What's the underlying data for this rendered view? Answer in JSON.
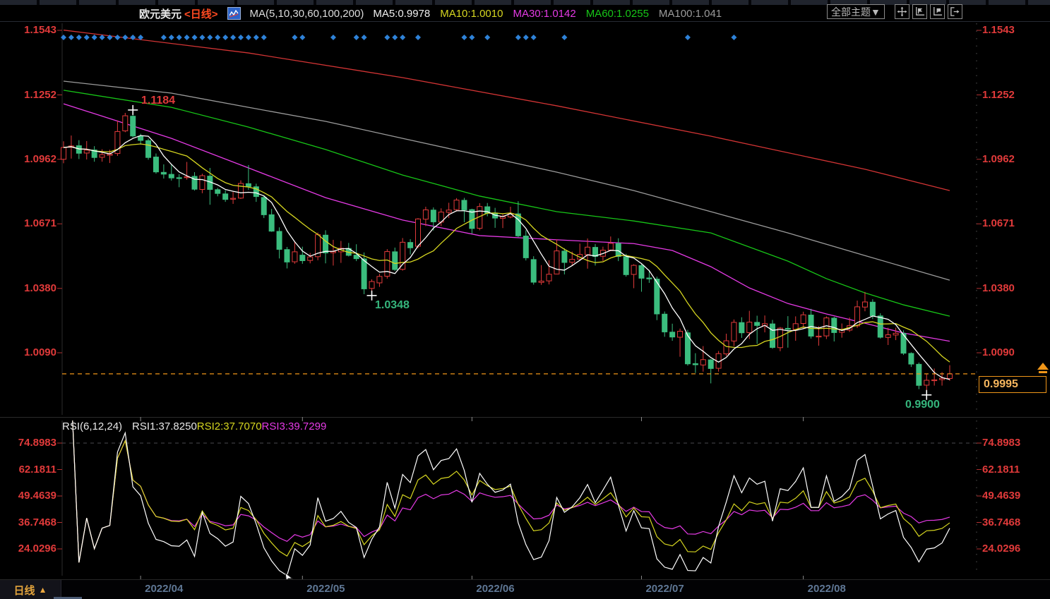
{
  "header": {
    "title": "欧元美元",
    "period_tag": "<日线>",
    "ma_param_label": "MA(5,10,30,60,100,200)",
    "ma_values": [
      {
        "label": "MA5:0.9978",
        "color": "#f0f0f0"
      },
      {
        "label": "MA10:1.0010",
        "color": "#d6d620"
      },
      {
        "label": "MA30:1.0142",
        "color": "#e53ae5"
      },
      {
        "label": "MA60:1.0255",
        "color": "#17c517"
      },
      {
        "label": "MA100:1.041",
        "color": "#9b9b9b"
      }
    ],
    "theme_button": "全部主题▼"
  },
  "main_chart": {
    "left_axis": [
      "1.1543",
      "1.1252",
      "1.0962",
      "1.0671",
      "1.0380",
      "1.0090"
    ],
    "right_axis": [
      "1.1543",
      "1.1252",
      "1.0962",
      "1.0671",
      "1.0380",
      "1.0090"
    ],
    "annotations": {
      "high": "1.1184",
      "low_may": "1.0348",
      "low_aug": "0.9900"
    },
    "current_price": "0.9995"
  },
  "rsi_panel": {
    "param_label": "RSI(6,12,24)",
    "values": [
      {
        "label": "RSI1:37.8250",
        "color": "#e8e8e8"
      },
      {
        "label": "RSI2:37.7070",
        "color": "#d6d620"
      },
      {
        "label": "RSI3:39.7299",
        "color": "#e53ae5"
      }
    ],
    "axis": [
      "74.8983",
      "62.1811",
      "49.4639",
      "36.7468",
      "24.0296"
    ]
  },
  "bottom_bar": {
    "period_label": "日线",
    "arrow": "▲"
  },
  "chart_data": {
    "type": "candlestick",
    "symbol": "欧元美元",
    "period": "日线",
    "year": "2022",
    "y_axis_ticks": [
      1.1543,
      1.1252,
      1.0962,
      1.0671,
      1.038,
      1.009
    ],
    "current_price": 0.9995,
    "colors": {
      "up": "#e23b3b",
      "down": "#3bbd7e",
      "ma5": "#ffffff",
      "ma10": "#d6d620",
      "ma30": "#e53ae5",
      "ma60": "#17c517",
      "ma100": "#9b9b9b",
      "ma200": "#d23434",
      "event_dot": "#2e82d8",
      "price_line": "#f09619",
      "axis_text": "#e03a3a"
    },
    "candles": [
      [
        "03-18",
        1.0962,
        1.1043,
        1.0944,
        1.1015
      ],
      [
        "03-21",
        1.1016,
        1.1069,
        1.0965,
        1.1022
      ],
      [
        "03-22",
        1.1023,
        1.1048,
        1.0963,
        1.0989
      ],
      [
        "03-23",
        1.099,
        1.1044,
        1.0961,
        1.1003
      ],
      [
        "03-24",
        1.1004,
        1.1021,
        1.0951,
        1.097
      ],
      [
        "03-25",
        1.0971,
        1.1007,
        1.0951,
        1.0983
      ],
      [
        "03-28",
        1.098,
        1.1005,
        1.0945,
        1.0985
      ],
      [
        "03-29",
        1.0988,
        1.1137,
        1.0977,
        1.1087
      ],
      [
        "03-30",
        1.109,
        1.1171,
        1.1084,
        1.1158
      ],
      [
        "03-31",
        1.1156,
        1.1184,
        1.106,
        1.1067
      ],
      [
        "04-01",
        1.1066,
        1.1077,
        1.1028,
        1.1047
      ],
      [
        "04-04",
        1.1046,
        1.1055,
        1.096,
        1.097
      ],
      [
        "04-05",
        1.0972,
        1.0988,
        1.0897,
        1.0905
      ],
      [
        "04-06",
        1.0903,
        1.0939,
        1.0875,
        1.0895
      ],
      [
        "04-07",
        1.0894,
        1.094,
        1.0866,
        1.0878
      ],
      [
        "04-08",
        1.0879,
        1.0895,
        1.0836,
        1.0876
      ],
      [
        "04-11",
        1.088,
        1.095,
        1.087,
        1.0883
      ],
      [
        "04-12",
        1.0885,
        1.0904,
        1.0821,
        1.0827
      ],
      [
        "04-13",
        1.0826,
        1.0897,
        1.0809,
        1.0888
      ],
      [
        "04-14",
        1.0886,
        1.0923,
        1.0757,
        1.0826
      ],
      [
        "04-15",
        1.0825,
        1.0833,
        1.0795,
        1.0808
      ],
      [
        "04-18",
        1.0806,
        1.0822,
        1.077,
        1.0781
      ],
      [
        "04-19",
        1.0782,
        1.0815,
        1.0761,
        1.0786
      ],
      [
        "04-20",
        1.0787,
        1.0867,
        1.0783,
        1.0853
      ],
      [
        "04-21",
        1.0852,
        1.0936,
        1.0824,
        1.0839
      ],
      [
        "04-22",
        1.0838,
        1.0852,
        1.077,
        1.0794
      ],
      [
        "04-25",
        1.079,
        1.08,
        1.0697,
        1.0712
      ],
      [
        "04-26",
        1.0712,
        1.0738,
        1.0635,
        1.0638
      ],
      [
        "04-27",
        1.0637,
        1.0655,
        1.0515,
        1.0556
      ],
      [
        "04-28",
        1.0555,
        1.0567,
        1.047,
        1.0499
      ],
      [
        "04-29",
        1.05,
        1.0593,
        1.0491,
        1.0545
      ],
      [
        "05-02",
        1.053,
        1.0568,
        1.0491,
        1.0505
      ],
      [
        "05-03",
        1.0506,
        1.054,
        1.0493,
        1.0522
      ],
      [
        "05-04",
        1.0523,
        1.0632,
        1.0507,
        1.0622
      ],
      [
        "05-05",
        1.062,
        1.0642,
        1.0493,
        1.054
      ],
      [
        "05-06",
        1.0541,
        1.0599,
        1.0483,
        1.0546
      ],
      [
        "05-09",
        1.0545,
        1.0594,
        1.0495,
        1.0561
      ],
      [
        "05-10",
        1.056,
        1.0585,
        1.0524,
        1.0529
      ],
      [
        "05-11",
        1.053,
        1.0579,
        1.0503,
        1.0514
      ],
      [
        "05-12",
        1.0513,
        1.0542,
        1.0354,
        1.0378
      ],
      [
        "05-13",
        1.038,
        1.0421,
        1.0348,
        1.0411
      ],
      [
        "05-16",
        1.0405,
        1.0446,
        1.0387,
        1.0434
      ],
      [
        "05-17",
        1.0435,
        1.0557,
        1.0424,
        1.0546
      ],
      [
        "05-18",
        1.0545,
        1.0564,
        1.0459,
        1.0465
      ],
      [
        "05-19",
        1.0466,
        1.0607,
        1.046,
        1.0588
      ],
      [
        "05-20",
        1.0587,
        1.0602,
        1.0533,
        1.0563
      ],
      [
        "05-23",
        1.057,
        1.0697,
        1.0561,
        1.0693
      ],
      [
        "05-24",
        1.0692,
        1.0748,
        1.0661,
        1.0734
      ],
      [
        "05-25",
        1.0733,
        1.0745,
        1.0641,
        1.068
      ],
      [
        "05-26",
        1.0679,
        1.0741,
        1.0661,
        1.0724
      ],
      [
        "05-27",
        1.0723,
        1.0766,
        1.0697,
        1.0733
      ],
      [
        "05-30",
        1.0735,
        1.0787,
        1.0727,
        1.0778
      ],
      [
        "05-31",
        1.0777,
        1.0788,
        1.0678,
        1.0734
      ],
      [
        "06-01",
        1.0735,
        1.0739,
        1.0627,
        1.065
      ],
      [
        "06-02",
        1.0651,
        1.0764,
        1.0642,
        1.0749
      ],
      [
        "06-03",
        1.0748,
        1.0765,
        1.0705,
        1.0719
      ],
      [
        "06-06",
        1.072,
        1.0743,
        1.0653,
        1.0697
      ],
      [
        "06-07",
        1.0696,
        1.0714,
        1.0652,
        1.0703
      ],
      [
        "06-08",
        1.0702,
        1.0748,
        1.0696,
        1.0717
      ],
      [
        "06-09",
        1.0716,
        1.0773,
        1.0611,
        1.0617
      ],
      [
        "06-10",
        1.0616,
        1.0642,
        1.0506,
        1.0518
      ],
      [
        "06-13",
        1.051,
        1.0525,
        1.0397,
        1.0408
      ],
      [
        "06-14",
        1.0407,
        1.0485,
        1.0396,
        1.0413
      ],
      [
        "06-15",
        1.0414,
        1.0507,
        1.0398,
        1.0444
      ],
      [
        "06-16",
        1.0445,
        1.0601,
        1.0444,
        1.0549
      ],
      [
        "06-17",
        1.0548,
        1.0561,
        1.0443,
        1.0497
      ],
      [
        "06-20",
        1.0498,
        1.0546,
        1.0482,
        1.0511
      ],
      [
        "06-21",
        1.0512,
        1.0582,
        1.0508,
        1.0533
      ],
      [
        "06-22",
        1.0532,
        1.0605,
        1.0469,
        1.0566
      ],
      [
        "06-23",
        1.0565,
        1.058,
        1.0483,
        1.0524
      ],
      [
        "06-24",
        1.0525,
        1.0568,
        1.0503,
        1.0552
      ],
      [
        "06-27",
        1.0553,
        1.0614,
        1.0548,
        1.0583
      ],
      [
        "06-28",
        1.0582,
        1.0606,
        1.0503,
        1.0524
      ],
      [
        "06-29",
        1.0523,
        1.0536,
        1.0433,
        1.0442
      ],
      [
        "06-30",
        1.0443,
        1.0489,
        1.0381,
        1.0484
      ],
      [
        "07-01",
        1.0483,
        1.049,
        1.0365,
        1.0426
      ],
      [
        "07-04",
        1.0427,
        1.0463,
        1.0405,
        1.0423
      ],
      [
        "07-05",
        1.0422,
        1.0433,
        1.0237,
        1.0265
      ],
      [
        "07-06",
        1.0264,
        1.0276,
        1.0162,
        1.0184
      ],
      [
        "07-07",
        1.0183,
        1.0221,
        1.0144,
        1.0161
      ],
      [
        "07-08",
        1.016,
        1.0199,
        1.0072,
        1.0187
      ],
      [
        "07-11",
        1.018,
        1.0193,
        1.0032,
        1.004
      ],
      [
        "07-12",
        1.0041,
        1.0088,
        0.9999,
        1.0036
      ],
      [
        "07-13",
        1.0035,
        1.012,
        1.0005,
        1.0059
      ],
      [
        "07-14",
        1.0058,
        1.0062,
        0.9952,
        1.0019
      ],
      [
        "07-15",
        1.002,
        1.0098,
        1.0005,
        1.0086
      ],
      [
        "07-18",
        1.0085,
        1.0176,
        1.0075,
        1.0144
      ],
      [
        "07-19",
        1.0143,
        1.024,
        1.012,
        1.0227
      ],
      [
        "07-20",
        1.0226,
        1.025,
        1.0157,
        1.018
      ],
      [
        "07-21",
        1.0181,
        1.0279,
        1.0152,
        1.0228
      ],
      [
        "07-22",
        1.0227,
        1.0257,
        1.013,
        1.0213
      ],
      [
        "07-25",
        1.0212,
        1.0258,
        1.0182,
        1.0221
      ],
      [
        "07-26",
        1.022,
        1.0238,
        1.0108,
        1.0114
      ],
      [
        "07-27",
        1.0113,
        1.0206,
        1.0097,
        1.0201
      ],
      [
        "07-28",
        1.02,
        1.0255,
        1.0113,
        1.0196
      ],
      [
        "07-29",
        1.0195,
        1.0254,
        1.0144,
        1.0221
      ],
      [
        "08-01",
        1.0222,
        1.0275,
        1.0199,
        1.0261
      ],
      [
        "08-02",
        1.026,
        1.0288,
        1.0154,
        1.0165
      ],
      [
        "08-03",
        1.0164,
        1.021,
        1.0122,
        1.0165
      ],
      [
        "08-04",
        1.0166,
        1.0254,
        1.0152,
        1.0247
      ],
      [
        "08-05",
        1.0246,
        1.0252,
        1.0141,
        1.0181
      ],
      [
        "08-08",
        1.0182,
        1.0222,
        1.0158,
        1.0193
      ],
      [
        "08-09",
        1.0192,
        1.0249,
        1.0184,
        1.0212
      ],
      [
        "08-10",
        1.0211,
        1.0325,
        1.0202,
        1.0297
      ],
      [
        "08-11",
        1.0296,
        1.0364,
        1.0277,
        1.0319
      ],
      [
        "08-12",
        1.0318,
        1.0331,
        1.0242,
        1.0257
      ],
      [
        "08-15",
        1.0256,
        1.0268,
        1.0154,
        1.016
      ],
      [
        "08-16",
        1.0159,
        1.0203,
        1.0125,
        1.0171
      ],
      [
        "08-17",
        1.017,
        1.0203,
        1.0147,
        1.0178
      ],
      [
        "08-18",
        1.0177,
        1.0191,
        1.008,
        1.0088
      ],
      [
        "08-19",
        1.0087,
        1.0092,
        1.0026,
        1.0039
      ],
      [
        "08-22",
        1.0038,
        1.0046,
        0.9926,
        0.9943
      ],
      [
        "08-23",
        0.9944,
        0.9994,
        0.99,
        0.9966
      ],
      [
        "08-24",
        0.9965,
        1.0019,
        0.9942,
        0.9968
      ],
      [
        "08-25",
        0.9969,
        1.0003,
        0.9942,
        0.9975
      ],
      [
        "08-26",
        0.9974,
        1.0034,
        0.9964,
        0.9995
      ]
    ],
    "marked_points": [
      {
        "name": "high",
        "index": 9,
        "price": 1.1184,
        "label": "1.1184"
      },
      {
        "name": "low_may",
        "index": 40,
        "price": 1.0348,
        "label": "1.0348"
      },
      {
        "name": "low_aug",
        "index": 112,
        "price": 0.99,
        "label": "0.9900"
      }
    ],
    "ma_short": [
      {
        "name": "MA5",
        "period": 5,
        "color": "#ffffff"
      },
      {
        "name": "MA10",
        "period": 10,
        "color": "#d6d620"
      }
    ],
    "ma_overlays": [
      {
        "name": "MA200",
        "color": "#d23434",
        "points": [
          [
            0,
            1.1544
          ],
          [
            24,
            1.1441
          ],
          [
            44,
            1.133
          ],
          [
            64,
            1.1203
          ],
          [
            84,
            1.1066
          ],
          [
            104,
            1.0917
          ],
          [
            115,
            1.0821
          ]
        ]
      },
      {
        "name": "MA100",
        "color": "#9b9b9b",
        "points": [
          [
            0,
            1.1314
          ],
          [
            14,
            1.126
          ],
          [
            24,
            1.1196
          ],
          [
            34,
            1.1133
          ],
          [
            44,
            1.1056
          ],
          [
            54,
            1.098
          ],
          [
            64,
            1.0904
          ],
          [
            74,
            1.0821
          ],
          [
            84,
            1.0726
          ],
          [
            94,
            1.063
          ],
          [
            104,
            1.0528
          ],
          [
            115,
            1.0417
          ]
        ]
      },
      {
        "name": "MA60",
        "color": "#17c517",
        "points": [
          [
            0,
            1.1273
          ],
          [
            14,
            1.1196
          ],
          [
            24,
            1.1107
          ],
          [
            34,
            1.1006
          ],
          [
            44,
            1.0891
          ],
          [
            54,
            1.0796
          ],
          [
            64,
            1.0726
          ],
          [
            74,
            1.0684
          ],
          [
            84,
            1.063
          ],
          [
            94,
            1.0503
          ],
          [
            99,
            1.0424
          ],
          [
            104,
            1.036
          ],
          [
            109,
            1.0306
          ],
          [
            115,
            1.0255
          ]
        ]
      },
      {
        "name": "MA30",
        "color": "#e53ae5",
        "points": [
          [
            0,
            1.1212
          ],
          [
            14,
            1.1056
          ],
          [
            24,
            1.0923
          ],
          [
            34,
            1.0789
          ],
          [
            44,
            1.0688
          ],
          [
            54,
            1.0618
          ],
          [
            64,
            1.0599
          ],
          [
            74,
            1.0582
          ],
          [
            79,
            1.0551
          ],
          [
            84,
            1.0478
          ],
          [
            89,
            1.0382
          ],
          [
            94,
            1.0312
          ],
          [
            99,
            1.0265
          ],
          [
            104,
            1.0223
          ],
          [
            109,
            1.0179
          ],
          [
            115,
            1.0142
          ]
        ]
      }
    ],
    "event_dot_indices": [
      0,
      1,
      2,
      3,
      4,
      5,
      6,
      7,
      8,
      9,
      10,
      13,
      14,
      15,
      16,
      17,
      18,
      19,
      20,
      21,
      22,
      23,
      24,
      25,
      26,
      30,
      31,
      35,
      38,
      39,
      42,
      43,
      44,
      46,
      52,
      53,
      55,
      59,
      60,
      61,
      65,
      81,
      87
    ],
    "x_month_labels": [
      {
        "label": "2022/04",
        "index": 10
      },
      {
        "label": "2022/05",
        "index": 31
      },
      {
        "label": "2022/06",
        "index": 53
      },
      {
        "label": "2022/07",
        "index": 75
      },
      {
        "label": "2022/08",
        "index": 96
      }
    ],
    "rsi": {
      "type": "line",
      "periods": [
        6,
        12,
        24
      ],
      "legend": [
        "RSI1:37.8250",
        "RSI2:37.7070",
        "RSI3:39.7299"
      ],
      "last_values": [
        37.825,
        37.707,
        39.7299
      ],
      "y_ticks": [
        74.8983,
        62.1811,
        49.4639,
        36.7468,
        24.0296
      ],
      "line_colors": [
        "#ffffff",
        "#d6d620",
        "#e53ae5"
      ],
      "top_gridline": 74.8983
    }
  }
}
